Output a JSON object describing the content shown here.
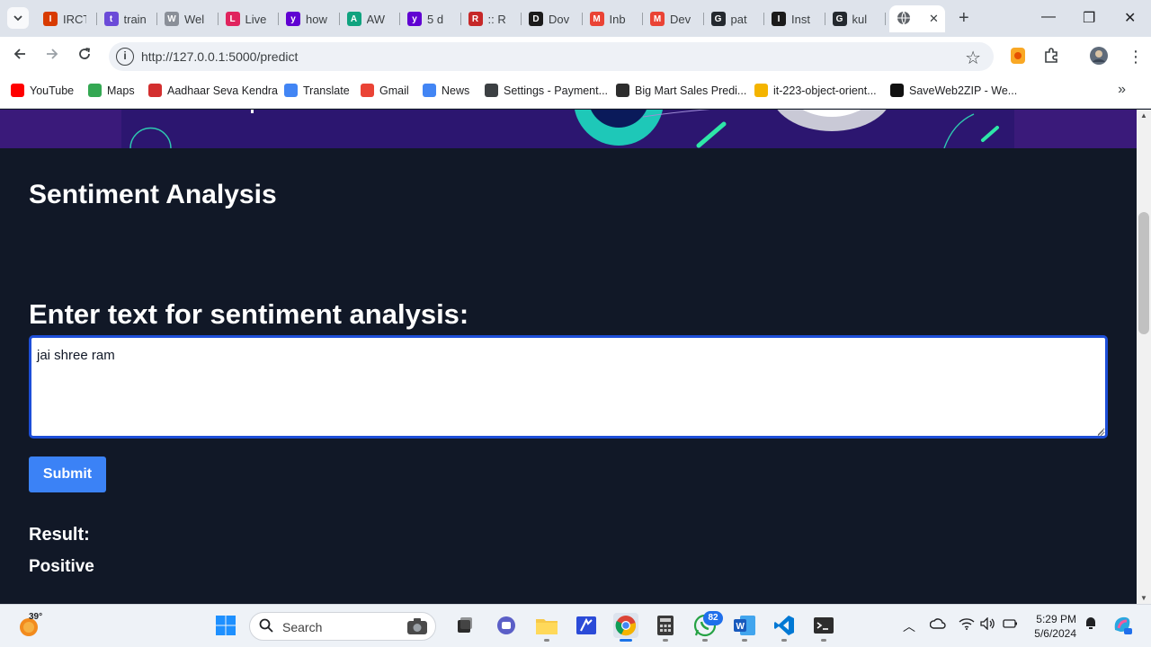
{
  "browser": {
    "tabs": [
      {
        "title": "IRCT",
        "icon": "irctc-icon",
        "color": "#d83b01",
        "glyph": "I"
      },
      {
        "title": "train",
        "icon": "train-icon",
        "color": "#6b4bd8",
        "glyph": "t"
      },
      {
        "title": "Wel",
        "icon": "globe-icon",
        "color": "#8a8f98",
        "glyph": "W"
      },
      {
        "title": "Live",
        "icon": "live-icon",
        "color": "#e0245e",
        "glyph": "L"
      },
      {
        "title": "how",
        "icon": "yahoo-icon",
        "color": "#6001d2",
        "glyph": "y"
      },
      {
        "title": "AW",
        "icon": "chatgpt-icon",
        "color": "#10a37f",
        "glyph": "A"
      },
      {
        "title": "5 d",
        "icon": "yahoo-icon",
        "color": "#6001d2",
        "glyph": "y"
      },
      {
        "title": ":: R",
        "icon": "r-icon",
        "color": "#c62828",
        "glyph": "R"
      },
      {
        "title": "Dov",
        "icon": "terminal-icon",
        "color": "#1b1b1b",
        "glyph": "D"
      },
      {
        "title": "Inb",
        "icon": "gmail-icon",
        "color": "#ea4335",
        "glyph": "M"
      },
      {
        "title": "Dev",
        "icon": "gmail-icon",
        "color": "#ea4335",
        "glyph": "M"
      },
      {
        "title": "pat",
        "icon": "github-icon",
        "color": "#24292f",
        "glyph": "G"
      },
      {
        "title": "Inst",
        "icon": "terminal-icon",
        "color": "#1b1b1b",
        "glyph": "I"
      },
      {
        "title": "kul",
        "icon": "github-icon",
        "color": "#24292f",
        "glyph": "G"
      }
    ],
    "active_tab_icon": "globe-icon",
    "url": "http://127.0.0.1:5000/predict",
    "bookmarks": [
      {
        "label": "YouTube",
        "icon": "youtube-icon",
        "color": "#ff0000"
      },
      {
        "label": "Maps",
        "icon": "maps-icon",
        "color": "#34a853"
      },
      {
        "label": "Aadhaar Seva Kendra",
        "icon": "aadhaar-icon",
        "color": "#d32f2f"
      },
      {
        "label": "Translate",
        "icon": "translate-icon",
        "color": "#4285f4"
      },
      {
        "label": "Gmail",
        "icon": "gmail-icon",
        "color": "#ea4335"
      },
      {
        "label": "News",
        "icon": "news-icon",
        "color": "#4285f4"
      },
      {
        "label": "Settings - Payment...",
        "icon": "gear-icon",
        "color": "#3c4043"
      },
      {
        "label": "Big Mart Sales Predi...",
        "icon": "terminal-icon",
        "color": "#2d2d2d"
      },
      {
        "label": "it-223-object-orient...",
        "icon": "drive-icon",
        "color": "#f4b400"
      },
      {
        "label": "SaveWeb2ZIP - We...",
        "icon": "rocket-icon",
        "color": "#111111"
      }
    ]
  },
  "page": {
    "title": "Sentiment Analysis",
    "prompt_label": "Enter text for sentiment analysis:",
    "textarea_value": "jai shree ram",
    "submit_label": "Submit",
    "result_label": "Result:",
    "result_value": "Positive"
  },
  "taskbar": {
    "weather_temp": "39°",
    "search_placeholder": "Search",
    "whatsapp_badge": "82",
    "time": "5:29 PM",
    "date": "5/6/2024"
  },
  "colors": {
    "accent": "#3b82f6",
    "page_bg": "#111827",
    "textarea_border": "#1d4ed8"
  }
}
